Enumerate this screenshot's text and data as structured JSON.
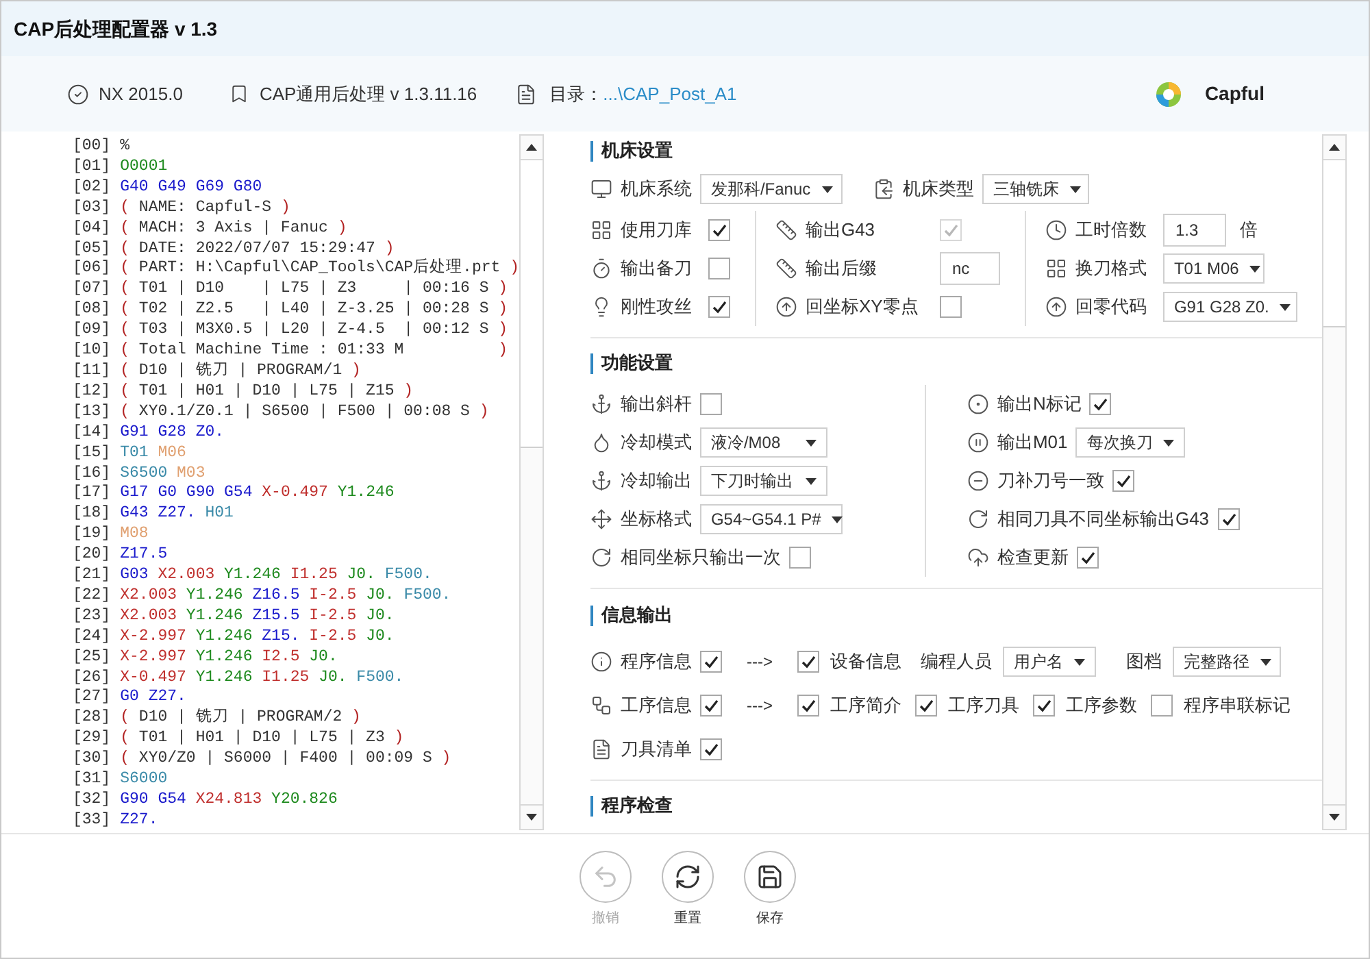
{
  "window": {
    "title": "CAP后处理配置器 v 1.3"
  },
  "header": {
    "nx": "NX 2015.0",
    "post": "CAP通用后处理 v 1.3.11.16",
    "dir_label": "目录：",
    "dir_path": "...\\CAP_Post_A1",
    "brand": "Capful"
  },
  "code": [
    {
      "n": "[00]",
      "tokens": [
        {
          "kind": "plain",
          "t": "%"
        }
      ]
    },
    {
      "n": "[01]",
      "tokens": [
        {
          "kind": "green",
          "t": "O0001"
        }
      ]
    },
    {
      "n": "[02]",
      "tokens": [
        {
          "kind": "blue",
          "t": "G40 G49 G69 G80"
        }
      ]
    },
    {
      "n": "[03]",
      "tokens": [
        {
          "kind": "paren",
          "t": "("
        },
        {
          "kind": "plain",
          "t": " NAME: Capful-S "
        },
        {
          "kind": "paren",
          "t": ")"
        }
      ]
    },
    {
      "n": "[04]",
      "tokens": [
        {
          "kind": "paren",
          "t": "("
        },
        {
          "kind": "plain",
          "t": " MACH: 3 Axis | Fanuc "
        },
        {
          "kind": "paren",
          "t": ")"
        }
      ]
    },
    {
      "n": "[05]",
      "tokens": [
        {
          "kind": "paren",
          "t": "("
        },
        {
          "kind": "plain",
          "t": " DATE: 2022/07/07 15:29:47 "
        },
        {
          "kind": "paren",
          "t": ")"
        }
      ]
    },
    {
      "n": "[06]",
      "tokens": [
        {
          "kind": "paren",
          "t": "("
        },
        {
          "kind": "plain",
          "t": " PART: H:\\Capful\\CAP_Tools\\CAP后处理.prt "
        },
        {
          "kind": "paren",
          "t": ")"
        }
      ]
    },
    {
      "n": "[07]",
      "tokens": [
        {
          "kind": "paren",
          "t": "("
        },
        {
          "kind": "plain",
          "t": " T01 | D10    | L75 | Z3     | 00:16 S "
        },
        {
          "kind": "paren",
          "t": ")"
        }
      ]
    },
    {
      "n": "[08]",
      "tokens": [
        {
          "kind": "paren",
          "t": "("
        },
        {
          "kind": "plain",
          "t": " T02 | Z2.5   | L40 | Z-3.25 | 00:28 S "
        },
        {
          "kind": "paren",
          "t": ")"
        }
      ]
    },
    {
      "n": "[09]",
      "tokens": [
        {
          "kind": "paren",
          "t": "("
        },
        {
          "kind": "plain",
          "t": " T03 | M3X0.5 | L20 | Z-4.5  | 00:12 S "
        },
        {
          "kind": "paren",
          "t": ")"
        }
      ]
    },
    {
      "n": "[10]",
      "tokens": [
        {
          "kind": "paren",
          "t": "("
        },
        {
          "kind": "plain",
          "t": " Total Machine Time : 01:33 M          "
        },
        {
          "kind": "paren",
          "t": ")"
        }
      ]
    },
    {
      "n": "[11]",
      "tokens": [
        {
          "kind": "paren",
          "t": "("
        },
        {
          "kind": "plain",
          "t": " D10 | 铣刀 | PROGRAM/1 "
        },
        {
          "kind": "paren",
          "t": ")"
        }
      ]
    },
    {
      "n": "[12]",
      "tokens": [
        {
          "kind": "paren",
          "t": "("
        },
        {
          "kind": "plain",
          "t": " T01 | H01 | D10 | L75 | Z15 "
        },
        {
          "kind": "paren",
          "t": ")"
        }
      ]
    },
    {
      "n": "[13]",
      "tokens": [
        {
          "kind": "paren",
          "t": "("
        },
        {
          "kind": "plain",
          "t": " XY0.1/Z0.1 | S6500 | F500 | 00:08 S "
        },
        {
          "kind": "paren",
          "t": ")"
        }
      ]
    },
    {
      "n": "[14]",
      "tokens": [
        {
          "kind": "blue",
          "t": "G91 G28 Z0."
        }
      ]
    },
    {
      "n": "[15]",
      "tokens": [
        {
          "kind": "teal",
          "t": "T01 "
        },
        {
          "kind": "orange",
          "t": "M06"
        }
      ]
    },
    {
      "n": "[16]",
      "tokens": [
        {
          "kind": "teal",
          "t": "S6500 "
        },
        {
          "kind": "orange",
          "t": "M03"
        }
      ]
    },
    {
      "n": "[17]",
      "tokens": [
        {
          "kind": "blue",
          "t": "G17 G0 G90 G54 "
        },
        {
          "kind": "red",
          "t": "X-0.497 "
        },
        {
          "kind": "green",
          "t": "Y1.246"
        }
      ]
    },
    {
      "n": "[18]",
      "tokens": [
        {
          "kind": "blue",
          "t": "G43 Z27. "
        },
        {
          "kind": "teal",
          "t": "H01"
        }
      ]
    },
    {
      "n": "[19]",
      "tokens": [
        {
          "kind": "orange",
          "t": "M08"
        }
      ]
    },
    {
      "n": "[20]",
      "tokens": [
        {
          "kind": "blue",
          "t": "Z17.5"
        }
      ]
    },
    {
      "n": "[21]",
      "tokens": [
        {
          "kind": "blue",
          "t": "G03 "
        },
        {
          "kind": "red",
          "t": "X2.003 "
        },
        {
          "kind": "green",
          "t": "Y1.246 "
        },
        {
          "kind": "red",
          "t": "I1.25 "
        },
        {
          "kind": "green",
          "t": "J0. "
        },
        {
          "kind": "teal",
          "t": "F500."
        }
      ]
    },
    {
      "n": "[22]",
      "tokens": [
        {
          "kind": "red",
          "t": "X2.003 "
        },
        {
          "kind": "green",
          "t": "Y1.246 "
        },
        {
          "kind": "blue",
          "t": "Z16.5 "
        },
        {
          "kind": "red",
          "t": "I-2.5 "
        },
        {
          "kind": "green",
          "t": "J0. "
        },
        {
          "kind": "teal",
          "t": "F500."
        }
      ]
    },
    {
      "n": "[23]",
      "tokens": [
        {
          "kind": "red",
          "t": "X2.003 "
        },
        {
          "kind": "green",
          "t": "Y1.246 "
        },
        {
          "kind": "blue",
          "t": "Z15.5 "
        },
        {
          "kind": "red",
          "t": "I-2.5 "
        },
        {
          "kind": "green",
          "t": "J0."
        }
      ]
    },
    {
      "n": "[24]",
      "tokens": [
        {
          "kind": "red",
          "t": "X-2.997 "
        },
        {
          "kind": "green",
          "t": "Y1.246 "
        },
        {
          "kind": "blue",
          "t": "Z15. "
        },
        {
          "kind": "red",
          "t": "I-2.5 "
        },
        {
          "kind": "green",
          "t": "J0."
        }
      ]
    },
    {
      "n": "[25]",
      "tokens": [
        {
          "kind": "red",
          "t": "X-2.997 "
        },
        {
          "kind": "green",
          "t": "Y1.246 "
        },
        {
          "kind": "red",
          "t": "I2.5 "
        },
        {
          "kind": "green",
          "t": "J0."
        }
      ]
    },
    {
      "n": "[26]",
      "tokens": [
        {
          "kind": "red",
          "t": "X-0.497 "
        },
        {
          "kind": "green",
          "t": "Y1.246 "
        },
        {
          "kind": "red",
          "t": "I1.25 "
        },
        {
          "kind": "green",
          "t": "J0. "
        },
        {
          "kind": "teal",
          "t": "F500."
        }
      ]
    },
    {
      "n": "[27]",
      "tokens": [
        {
          "kind": "blue",
          "t": "G0 Z27."
        }
      ]
    },
    {
      "n": "[28]",
      "tokens": [
        {
          "kind": "paren",
          "t": "("
        },
        {
          "kind": "plain",
          "t": " D10 | 铣刀 | PROGRAM/2 "
        },
        {
          "kind": "paren",
          "t": ")"
        }
      ]
    },
    {
      "n": "[29]",
      "tokens": [
        {
          "kind": "paren",
          "t": "("
        },
        {
          "kind": "plain",
          "t": " T01 | H01 | D10 | L75 | Z3 "
        },
        {
          "kind": "paren",
          "t": ")"
        }
      ]
    },
    {
      "n": "[30]",
      "tokens": [
        {
          "kind": "paren",
          "t": "("
        },
        {
          "kind": "plain",
          "t": " XY0/Z0 | S6000 | F400 | 00:09 S "
        },
        {
          "kind": "paren",
          "t": ")"
        }
      ]
    },
    {
      "n": "[31]",
      "tokens": [
        {
          "kind": "teal",
          "t": "S6000"
        }
      ]
    },
    {
      "n": "[32]",
      "tokens": [
        {
          "kind": "blue",
          "t": "G90 G54 "
        },
        {
          "kind": "red",
          "t": "X24.813 "
        },
        {
          "kind": "green",
          "t": "Y20.826"
        }
      ]
    },
    {
      "n": "[33]",
      "tokens": [
        {
          "kind": "blue",
          "t": "Z27."
        }
      ]
    }
  ],
  "machine_settings": {
    "title": "机床设置",
    "top": [
      {
        "label": "机床系统",
        "value": "发那科/Fanuc"
      },
      {
        "label": "机床类型",
        "value": "三轴铣床"
      }
    ],
    "columns": [
      [
        {
          "kind": "checkbox",
          "label": "使用刀库",
          "checked": true,
          "disabled": false
        },
        {
          "kind": "checkbox",
          "label": "输出备刀",
          "checked": false,
          "disabled": false
        },
        {
          "kind": "checkbox",
          "label": "刚性攻丝",
          "checked": true,
          "disabled": false
        }
      ],
      [
        {
          "kind": "checkbox",
          "label": "输出G43",
          "checked": true,
          "disabled": true
        },
        {
          "kind": "input",
          "label": "输出后缀",
          "value": "nc"
        },
        {
          "kind": "checkbox",
          "label": "回坐标XY零点",
          "checked": false,
          "disabled": false
        }
      ],
      [
        {
          "kind": "input",
          "label": "工时倍数",
          "value": "1.3",
          "suffix": "倍"
        },
        {
          "kind": "select",
          "label": "换刀格式",
          "value": "T01 M06"
        },
        {
          "kind": "select",
          "label": "回零代码",
          "value": "G91 G28 Z0."
        }
      ]
    ]
  },
  "function_settings": {
    "title": "功能设置",
    "columns": [
      [
        {
          "kind": "checkbox",
          "label": "输出斜杆",
          "checked": false,
          "disabled": false
        },
        {
          "kind": "select",
          "label": "冷却模式",
          "value": "液冷/M08"
        },
        {
          "kind": "select",
          "label": "冷却输出",
          "value": "下刀时输出"
        },
        {
          "kind": "select",
          "label": "坐标格式",
          "value": "G54~G54.1 P#"
        },
        {
          "kind": "checkbox",
          "label": "相同坐标只输出一次",
          "checked": false,
          "disabled": false
        }
      ],
      [
        {
          "kind": "checkbox",
          "label": "输出N标记",
          "checked": true,
          "disabled": false
        },
        {
          "kind": "select",
          "label": "输出M01",
          "value": "每次换刀"
        },
        {
          "kind": "checkbox",
          "label": "刀补刀号一致",
          "checked": true,
          "disabled": false
        },
        {
          "kind": "checkbox",
          "label": "相同刀具不同坐标输出G43",
          "checked": true,
          "disabled": false
        },
        {
          "kind": "checkbox",
          "label": "检查更新",
          "checked": true,
          "disabled": false
        }
      ]
    ]
  },
  "info_output": {
    "title": "信息输出",
    "rows": [
      [
        {
          "kind": "checkbox",
          "label": "程序信息",
          "checked": true
        },
        {
          "kind": "arrow",
          "text": "--->"
        },
        {
          "kind": "box_first",
          "label": "设备信息",
          "checked": true
        },
        {
          "kind": "select",
          "label": "编程人员",
          "value": "用户名"
        },
        {
          "kind": "select",
          "label": "图档",
          "value": "完整路径"
        }
      ],
      [
        {
          "kind": "checkbox",
          "label": "工序信息",
          "checked": true
        },
        {
          "kind": "arrow",
          "text": "--->"
        },
        {
          "kind": "box_first",
          "label": "工序简介",
          "checked": true
        },
        {
          "kind": "box_first",
          "label": "工序刀具",
          "checked": true
        },
        {
          "kind": "box_first",
          "label": "工序参数",
          "checked": true
        },
        {
          "kind": "box_first",
          "label": "程序串联标记",
          "checked": false
        }
      ],
      [
        {
          "kind": "checkbox",
          "label": "刀具清单",
          "checked": true
        }
      ]
    ]
  },
  "program_check": {
    "title": "程序检查"
  },
  "buttons": [
    {
      "label": "撤销",
      "disabled": true
    },
    {
      "label": "重置",
      "disabled": false
    },
    {
      "label": "保存",
      "disabled": false
    }
  ]
}
